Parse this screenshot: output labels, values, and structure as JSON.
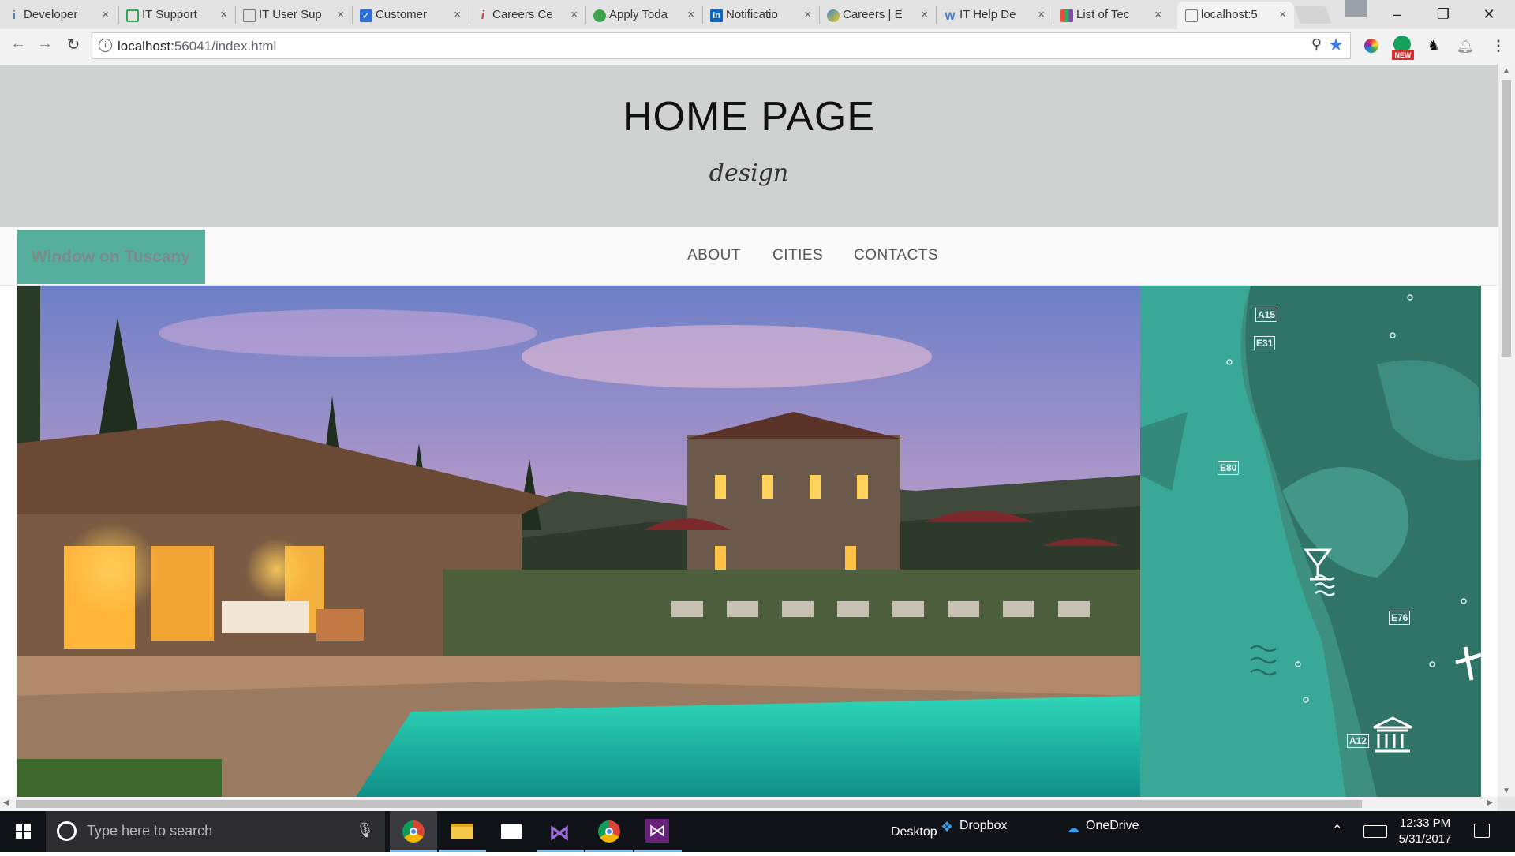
{
  "browser": {
    "tabs": [
      {
        "title": "Developer",
        "favicon": "info-icon",
        "color": "#4a7fd0"
      },
      {
        "title": "IT Support",
        "favicon": "doc-icon",
        "color": "#2fa84f"
      },
      {
        "title": "IT User Sup",
        "favicon": "page-icon",
        "color": "#777777"
      },
      {
        "title": "Customer",
        "favicon": "check-icon",
        "color": "#2f6fd1"
      },
      {
        "title": "Careers Ce",
        "favicon": "i-icon",
        "color": "#d33232"
      },
      {
        "title": "Apply Toda",
        "favicon": "hyl-icon",
        "color": "#3fa34d"
      },
      {
        "title": "Notificatio",
        "favicon": "linkedin-icon",
        "color": "#0a66c2"
      },
      {
        "title": "Careers | E",
        "favicon": "globe-icon",
        "color": "#3a8ad0"
      },
      {
        "title": "IT Help De",
        "favicon": "w-icon",
        "color": "#e59a1e"
      },
      {
        "title": "List of Tec",
        "favicon": "bars-icon",
        "color": "#8e44ad"
      },
      {
        "title": "localhost:5",
        "favicon": "page-icon",
        "color": "#777777"
      }
    ],
    "address": {
      "host": "localhost:",
      "path": "56041/index.html"
    },
    "extension_badge": "NEW"
  },
  "page": {
    "title": "HOME PAGE",
    "tagline": "design",
    "brand": "Window on Tuscany",
    "nav": [
      "ABOUT",
      "CITIES",
      "CONTACTS"
    ],
    "map_labels": [
      "A15",
      "E31",
      "E80",
      "E76",
      "A12"
    ]
  },
  "taskbar": {
    "search_placeholder": "Type here to search",
    "desktop_label": "Desktop",
    "dropbox_label": "Dropbox",
    "onedrive_label": "OneDrive",
    "time": "12:33 PM",
    "date": "5/31/2017"
  },
  "colors": {
    "header_bg": "#d0d2d1",
    "brand_bg": "#54b09d",
    "map_bg": "#3d8f80"
  }
}
